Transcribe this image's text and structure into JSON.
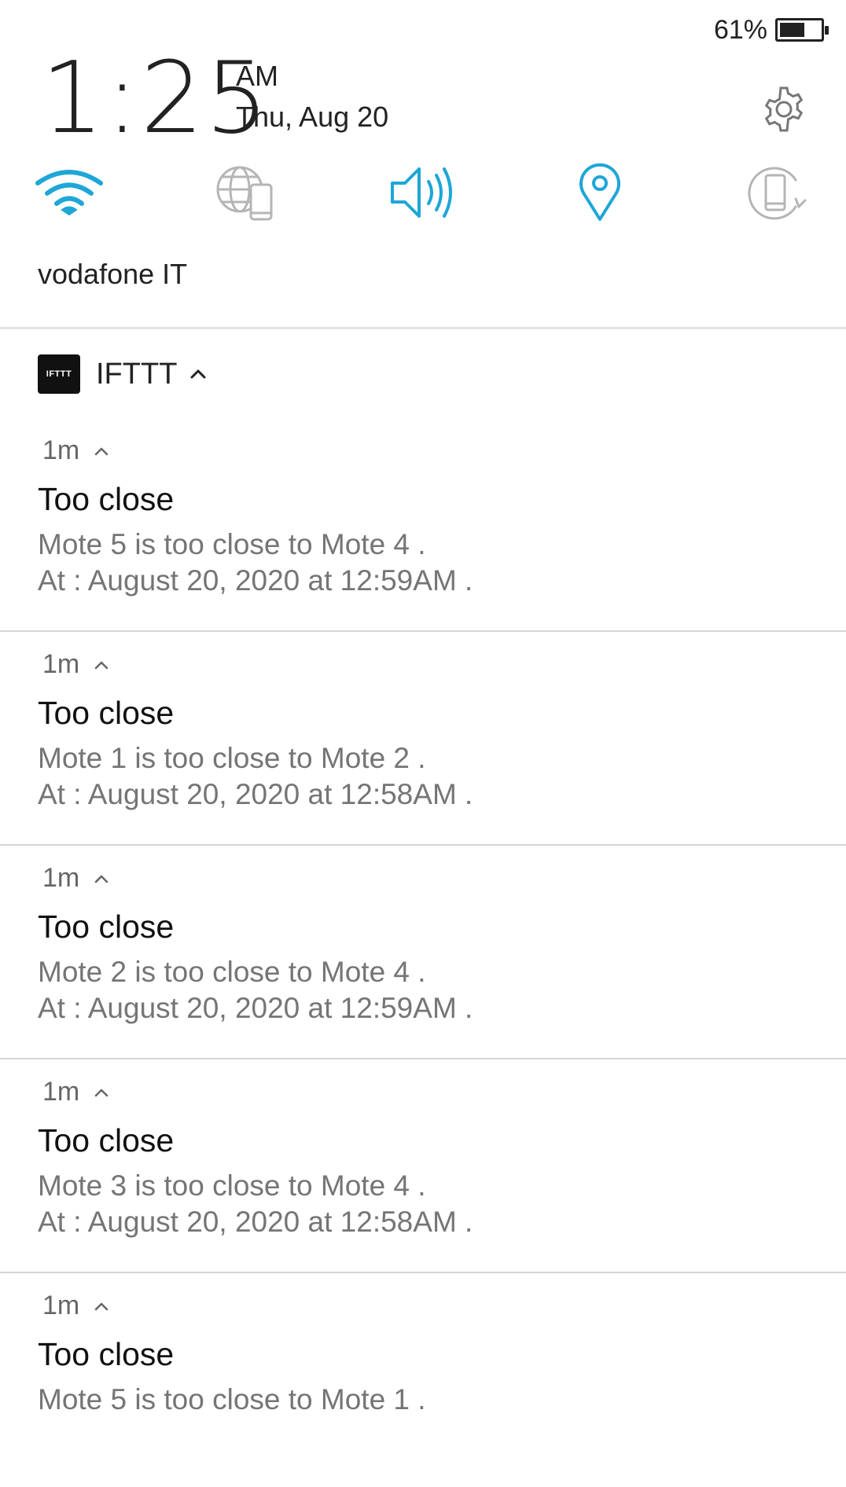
{
  "status_bar": {
    "battery_percent_label": "61%",
    "battery_level": 0.61
  },
  "clock": {
    "time": "1:25",
    "ampm": "AM",
    "date": "Thu, Aug 20"
  },
  "quick_settings": {
    "accent_color": "#1ea6d6",
    "inactive_color": "#b5b5b5",
    "tiles": [
      {
        "icon": "wifi-icon",
        "active": true
      },
      {
        "icon": "mobile-data-icon",
        "active": false
      },
      {
        "icon": "sound-icon",
        "active": true
      },
      {
        "icon": "location-icon",
        "active": true
      },
      {
        "icon": "auto-rotate-icon",
        "active": false
      }
    ]
  },
  "carrier": "vodafone IT",
  "app": {
    "logo_text": "IFTTT",
    "name": "IFTTT"
  },
  "notifications": [
    {
      "time": "1m",
      "title": "Too close",
      "line1": "Mote 5 is too close to Mote 4 .",
      "line2": "At : August 20, 2020 at 12:59AM ."
    },
    {
      "time": "1m",
      "title": "Too close",
      "line1": "Mote 1 is too close to Mote 2 .",
      "line2": "At : August 20, 2020 at 12:58AM ."
    },
    {
      "time": "1m",
      "title": "Too close",
      "line1": "Mote 2 is too close to Mote 4 .",
      "line2": "At : August 20, 2020 at 12:59AM ."
    },
    {
      "time": "1m",
      "title": "Too close",
      "line1": "Mote 3 is too close to Mote 4 .",
      "line2": "At : August 20, 2020 at 12:58AM ."
    },
    {
      "time": "1m",
      "title": "Too close",
      "line1": "Mote 5 is too close to Mote 1 .",
      "line2": ""
    }
  ]
}
